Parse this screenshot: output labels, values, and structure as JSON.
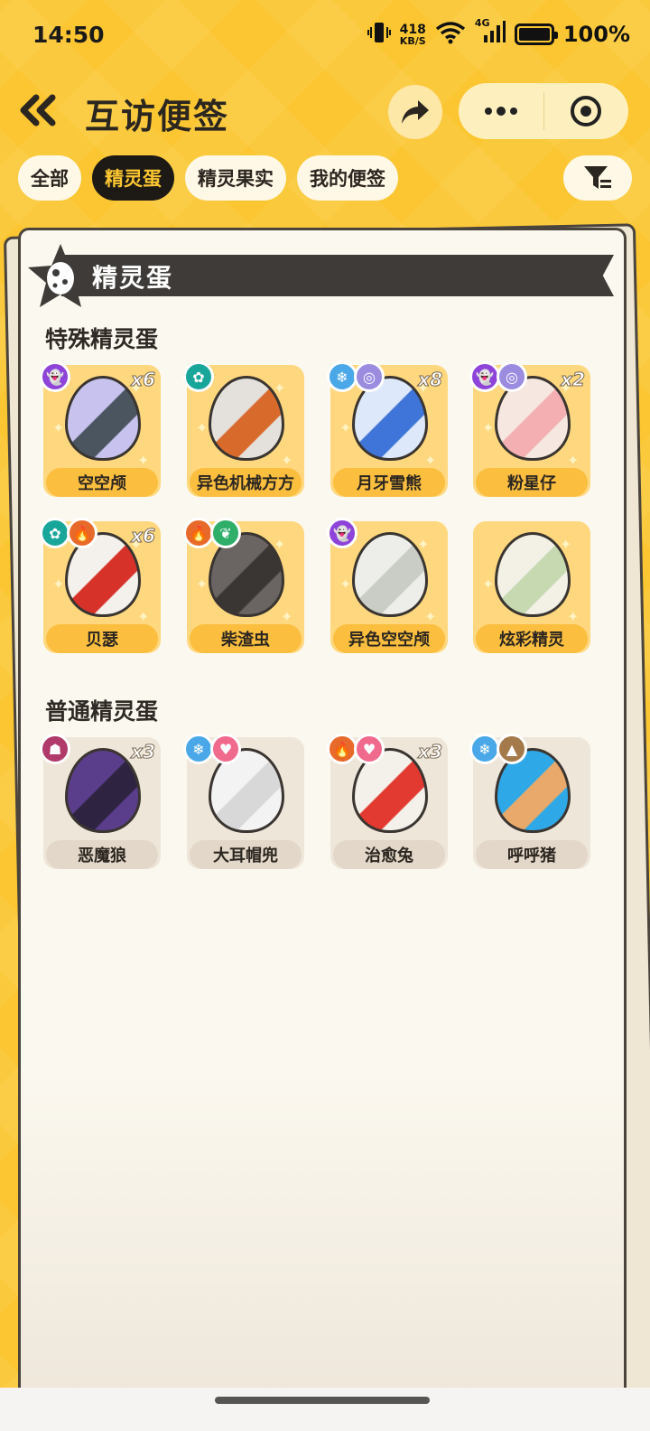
{
  "status_bar": {
    "time": "14:50",
    "net_speed_value": "418",
    "net_speed_unit": "KB/S",
    "network": "4G",
    "battery": "100%"
  },
  "header": {
    "title": "互访便签"
  },
  "tabs": [
    {
      "label": "全部",
      "active": false
    },
    {
      "label": "精灵蛋",
      "active": true
    },
    {
      "label": "精灵果实",
      "active": false
    },
    {
      "label": "我的便签",
      "active": false
    }
  ],
  "section": {
    "title": "精灵蛋"
  },
  "groups": [
    {
      "title": "特殊精灵蛋",
      "items": [
        {
          "name": "空空颅",
          "count": "x6",
          "badges": [
            "ghost-icon"
          ],
          "egg_colors": [
            "#C8C3EE",
            "#4A5560"
          ]
        },
        {
          "name": "异色机械方方",
          "count": "",
          "badges": [
            "gear-icon"
          ],
          "egg_colors": [
            "#E4E0DB",
            "#D86A2B"
          ]
        },
        {
          "name": "月牙雪熊",
          "count": "x8",
          "badges": [
            "snowflake-icon",
            "spiral-icon"
          ],
          "egg_colors": [
            "#DDE8FA",
            "#3F74D8"
          ]
        },
        {
          "name": "粉星仔",
          "count": "x2",
          "badges": [
            "ghost-icon",
            "spiral-icon"
          ],
          "egg_colors": [
            "#F6E8E0",
            "#F3AFB2"
          ]
        },
        {
          "name": "贝瑟",
          "count": "x6",
          "badges": [
            "gear-icon",
            "fire-icon"
          ],
          "egg_colors": [
            "#F4F1EC",
            "#D7322A"
          ]
        },
        {
          "name": "柴渣虫",
          "count": "",
          "badges": [
            "fire-icon",
            "leaf-icon"
          ],
          "egg_colors": [
            "#6A6562",
            "#3A3633"
          ]
        },
        {
          "name": "异色空空颅",
          "count": "",
          "badges": [
            "ghost-icon"
          ],
          "egg_colors": [
            "#EDEEEA",
            "#C9CDC6"
          ]
        },
        {
          "name": "炫彩精灵",
          "count": "",
          "badges": [],
          "egg_colors": [
            "#F3F0E6",
            "#C6D9B0"
          ]
        }
      ]
    },
    {
      "title": "普通精灵蛋",
      "items": [
        {
          "name": "恶魔狼",
          "count": "x3",
          "badges": [
            "demon-icon"
          ],
          "egg_colors": [
            "#5A3E8C",
            "#2E2442"
          ]
        },
        {
          "name": "大耳帽兜",
          "count": "",
          "badges": [
            "snowflake-icon",
            "heart-icon"
          ],
          "egg_colors": [
            "#F3F3F3",
            "#D8D8D8"
          ]
        },
        {
          "name": "治愈兔",
          "count": "x3",
          "badges": [
            "fire-icon",
            "heart-icon"
          ],
          "egg_colors": [
            "#F4F0EA",
            "#E23A30"
          ]
        },
        {
          "name": "呼呼猪",
          "count": "",
          "badges": [
            "snowflake-icon",
            "mountain-icon"
          ],
          "egg_colors": [
            "#2FA8E8",
            "#E8A96A"
          ]
        }
      ]
    }
  ],
  "badge_colors": {
    "ghost-icon": "#8E44D8",
    "gear-icon": "#19A69A",
    "snowflake-icon": "#4AA8E8",
    "spiral-icon": "#9B8CE0",
    "fire-icon": "#E86A2A",
    "leaf-icon": "#2FAE6A",
    "demon-icon": "#B03A6A",
    "heart-icon": "#F06A8E",
    "mountain-icon": "#A57A4A"
  },
  "badge_glyphs": {
    "ghost-icon": "👻",
    "gear-icon": "✿",
    "snowflake-icon": "❄",
    "spiral-icon": "◎",
    "fire-icon": "🔥",
    "leaf-icon": "❦",
    "demon-icon": "☗",
    "heart-icon": "♥",
    "mountain-icon": "▲"
  }
}
